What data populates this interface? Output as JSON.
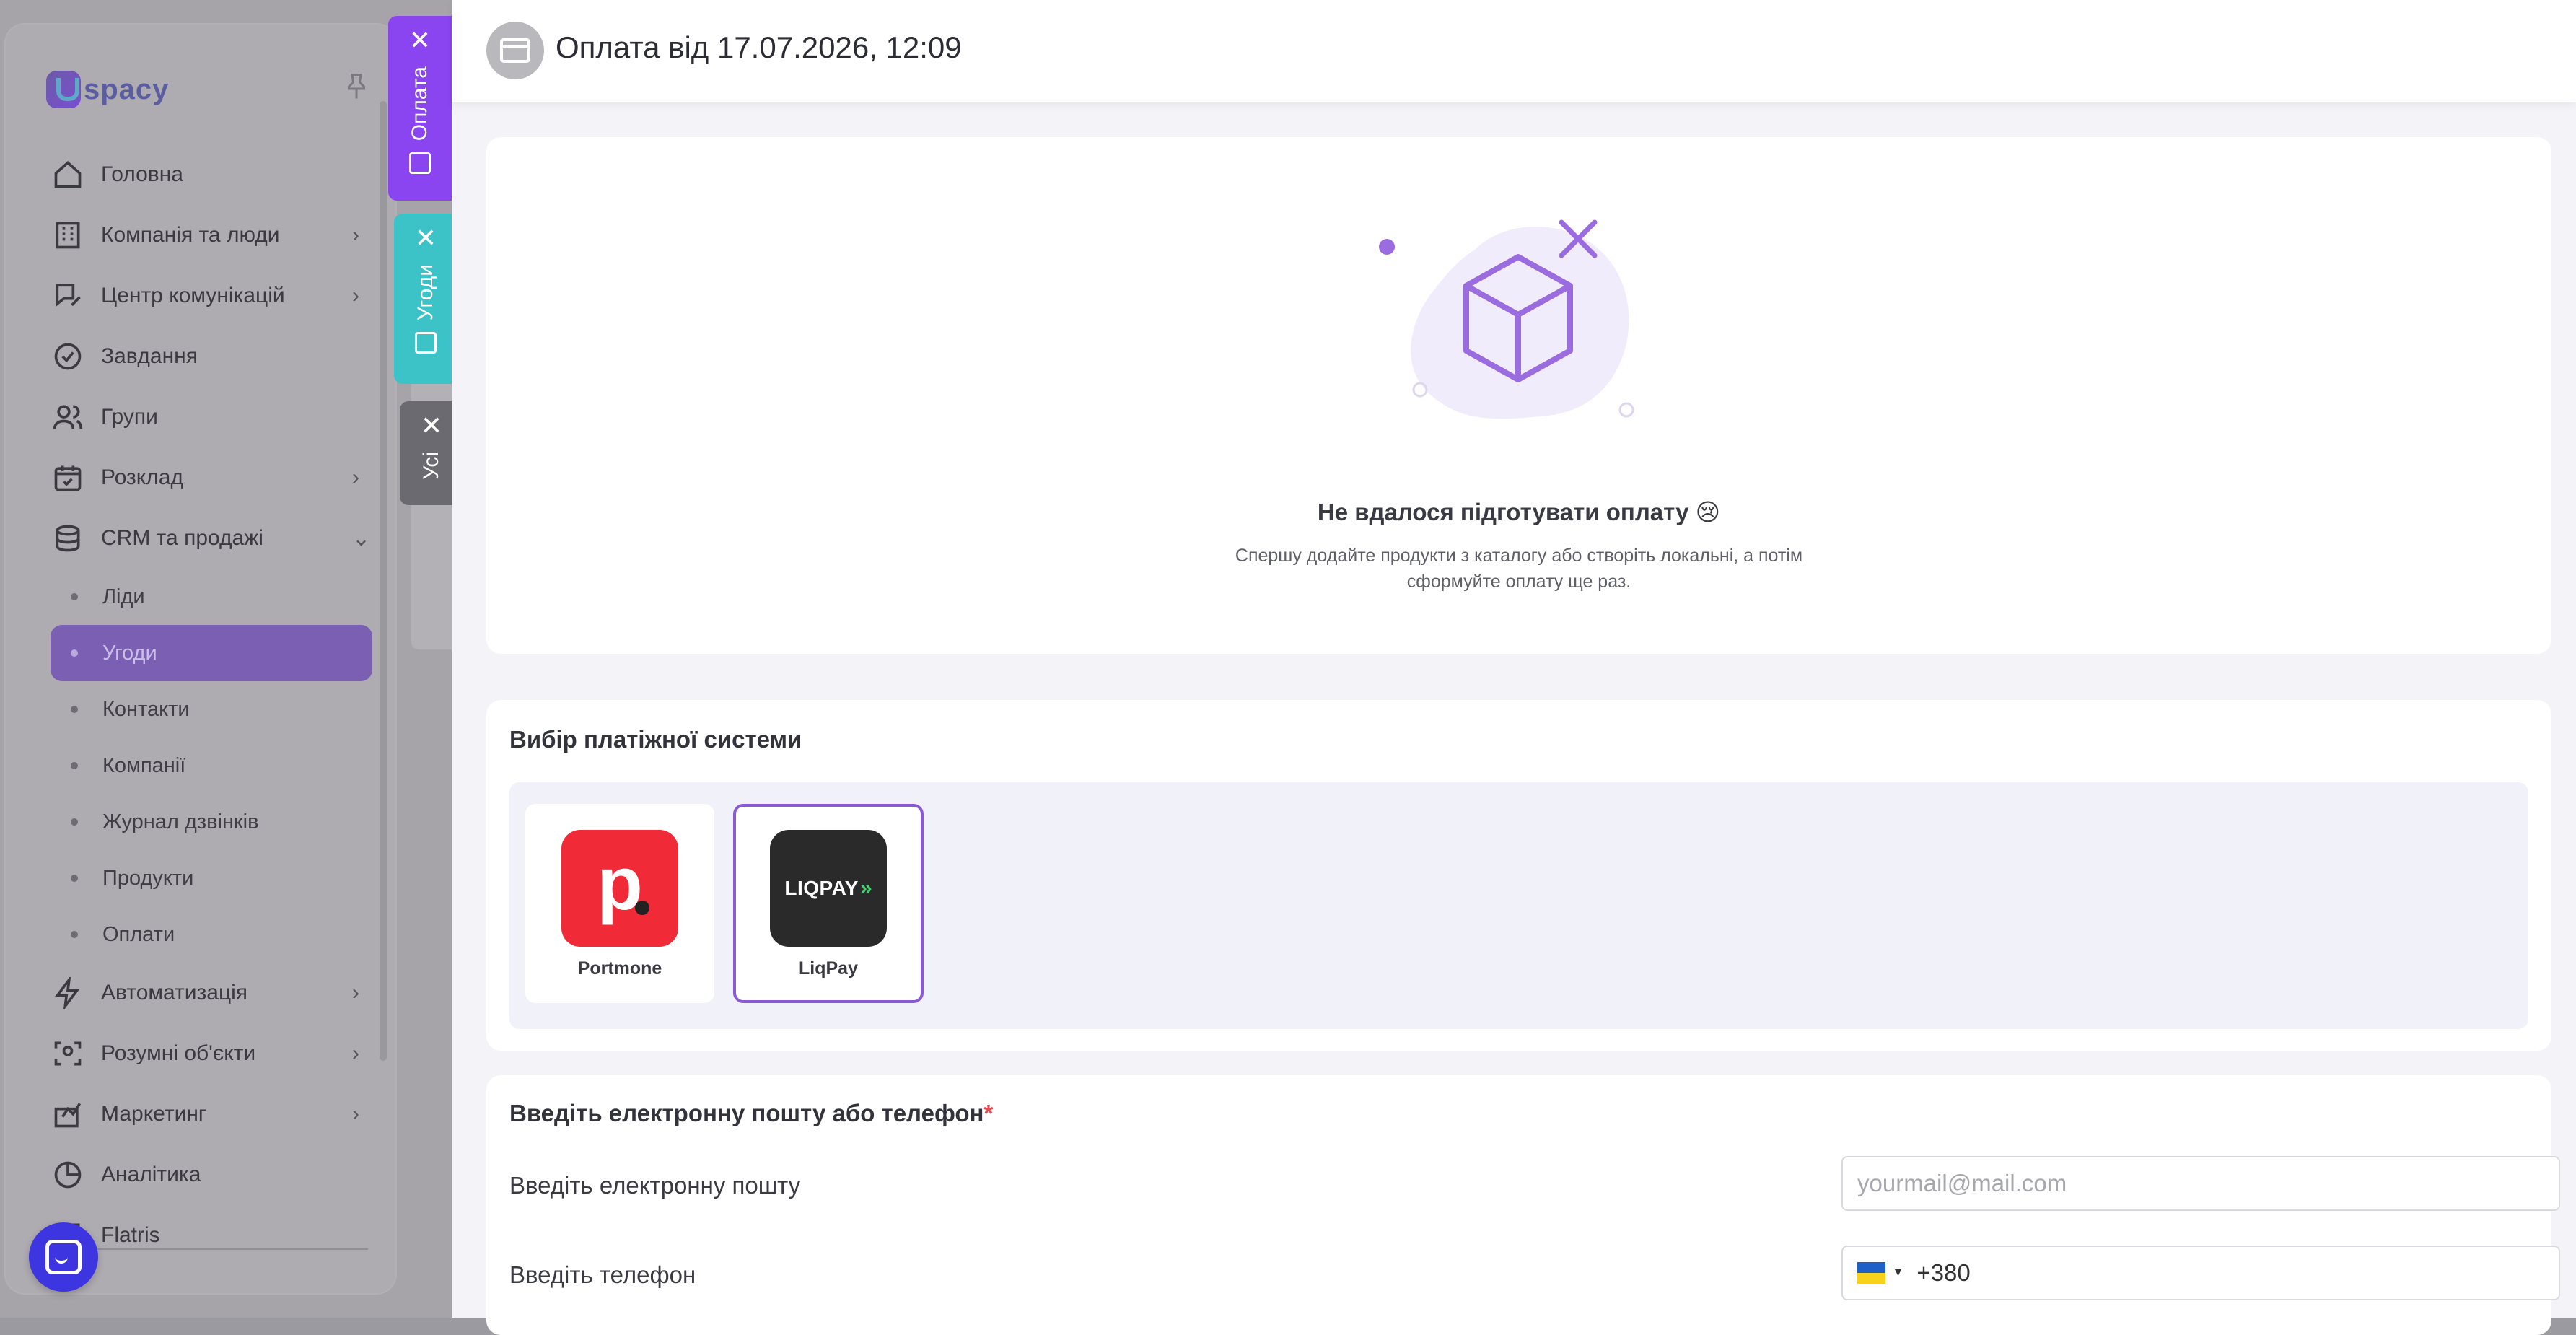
{
  "sidebar": {
    "logo_text": "spacy",
    "nav": [
      {
        "label": "Головна",
        "icon": "home-icon",
        "chevron": false
      },
      {
        "label": "Компанія та люди",
        "icon": "building-icon",
        "chevron": true
      },
      {
        "label": "Центр комунікацій",
        "icon": "chat-edit-icon",
        "chevron": true
      },
      {
        "label": "Завдання",
        "icon": "check-circle-icon",
        "chevron": false
      },
      {
        "label": "Групи",
        "icon": "users-icon",
        "chevron": false
      },
      {
        "label": "Розклад",
        "icon": "calendar-icon",
        "chevron": true
      },
      {
        "label": "CRM та продажі",
        "icon": "database-icon",
        "chevron": "down"
      }
    ],
    "crm_sub": [
      "Ліди",
      "Угоди",
      "Контакти",
      "Компанії",
      "Журнал дзвінків",
      "Продукти",
      "Оплати"
    ],
    "nav_bottom": [
      {
        "label": "Автоматизація",
        "icon": "lightning-icon",
        "chevron": true
      },
      {
        "label": "Розумні об'єкти",
        "icon": "scan-icon",
        "chevron": true
      },
      {
        "label": "Маркетинг",
        "icon": "megaphone-icon",
        "chevron": true
      },
      {
        "label": "Аналітика",
        "icon": "pie-chart-icon",
        "chevron": false
      },
      {
        "label": "Flatris",
        "icon": "grid-icon",
        "chevron": false
      }
    ]
  },
  "side_tabs": {
    "payment": "Оплата",
    "deals": "Угоди",
    "all": "Усі"
  },
  "header": {
    "title": "Оплата від 17.07.2026, 12:09"
  },
  "empty_state": {
    "title": "Не вдалося підготувати оплату 😢",
    "subtitle": "Спершу додайте продукти з каталогу або створіть локальні, а потім сформуйте оплату ще раз."
  },
  "payment_system": {
    "title": "Вибір платіжної системи",
    "options": [
      {
        "name": "Portmone",
        "logo_text": "p",
        "selected": false
      },
      {
        "name": "LiqPay",
        "logo_text": "LIQPAY",
        "selected": true
      }
    ]
  },
  "contact": {
    "title": "Введіть електронну пошту або телефон",
    "required_mark": "*",
    "email_label": "Введіть електронну пошту",
    "email_placeholder": "yourmail@mail.com",
    "phone_label": "Введіть телефон",
    "phone_value": "+380"
  },
  "colors": {
    "accent": "#8a44f0",
    "deals_tab": "#3cc3c8",
    "portmone": "#f02a36",
    "liqpay": "#2a2a2a"
  }
}
